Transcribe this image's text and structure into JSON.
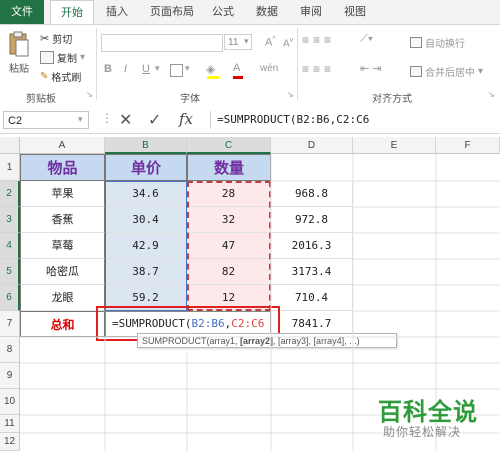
{
  "ribbon": {
    "tabs": [
      "文件",
      "开始",
      "插入",
      "页面布局",
      "公式",
      "数据",
      "审阅",
      "视图"
    ],
    "clipboard": {
      "paste": "粘贴",
      "cut": "剪切",
      "copy": "复制",
      "format_painter": "格式刷",
      "group_label": "剪贴板"
    },
    "font": {
      "size": "11",
      "group_label": "字体",
      "bold": "B",
      "italic": "I",
      "underline": "U",
      "grow": "A",
      "shrink": "A"
    },
    "align": {
      "wrap": "自动换行",
      "merge": "合并后居中",
      "group_label": "对齐方式"
    }
  },
  "formula_bar": {
    "name_box": "C2",
    "cancel": "✕",
    "enter": "✓",
    "fx": "fx",
    "formula": "=SUMPRODUCT(B2:B6,C2:C6"
  },
  "sheet": {
    "columns": [
      "A",
      "B",
      "C",
      "D",
      "E",
      "F"
    ],
    "rows": [
      "1",
      "2",
      "3",
      "4",
      "5",
      "6",
      "7",
      "8",
      "9",
      "10",
      "11",
      "12"
    ],
    "header": {
      "a": "物品",
      "b": "单价",
      "c": "数量"
    },
    "data": [
      {
        "item": "苹果",
        "price": "34.6",
        "qty": "28",
        "total": "968.8"
      },
      {
        "item": "香蕉",
        "price": "30.4",
        "qty": "32",
        "total": "972.8"
      },
      {
        "item": "草莓",
        "price": "42.9",
        "qty": "47",
        "total": "2016.3"
      },
      {
        "item": "哈密瓜",
        "price": "38.7",
        "qty": "82",
        "total": "3173.4"
      },
      {
        "item": "龙眼",
        "price": "59.2",
        "qty": "12",
        "total": "710.4"
      }
    ],
    "sum_label": "总和",
    "edit": {
      "prefix": "=SUMPRODUCT(",
      "ref1": "B2:B6",
      "sep": ",",
      "ref2": "C2:C6"
    },
    "sum_value": "7841.7",
    "tooltip": {
      "fn": "SUMPRODUCT(array1, ",
      "bold": "[array2]",
      "rest": ", [array3], [array4], ...)"
    }
  },
  "watermark": {
    "title": "百科全说",
    "subtitle": "助你轻松解决"
  },
  "colors": {
    "excel_green": "#217346",
    "header_fill": "#c5d9f1",
    "header_text": "#7030a0",
    "ref_blue": "#4472c4",
    "ref_red": "#e0443e"
  }
}
